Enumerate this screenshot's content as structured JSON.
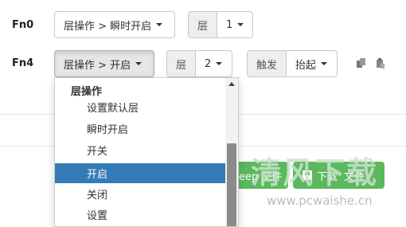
{
  "rows": [
    {
      "label": "Fn0",
      "action_value": "层操作 > 瞬时开启",
      "layer_label": "层",
      "layer_value": "1"
    },
    {
      "label": "Fn4",
      "action_value": "层操作 > 开启",
      "layer_label": "层",
      "layer_value": "2",
      "trigger_label": "触发",
      "trigger_value": "抬起"
    }
  ],
  "dropdown": {
    "header": "层操作",
    "items": [
      "设置默认层",
      "瞬时开启",
      "开关",
      "开启",
      "关闭",
      "设置"
    ],
    "selected": "开启"
  },
  "bottom_buttons": {
    "keep_file": "eep 文件",
    "download_file": "下载",
    "download_suffix": "文件"
  },
  "watermark": {
    "title": "清风下载",
    "url": "www.pcwaishe.cn"
  },
  "colors": {
    "selected_bg": "#337ab7",
    "green": "#5cb85c",
    "addon_bg": "#eeeeee"
  }
}
